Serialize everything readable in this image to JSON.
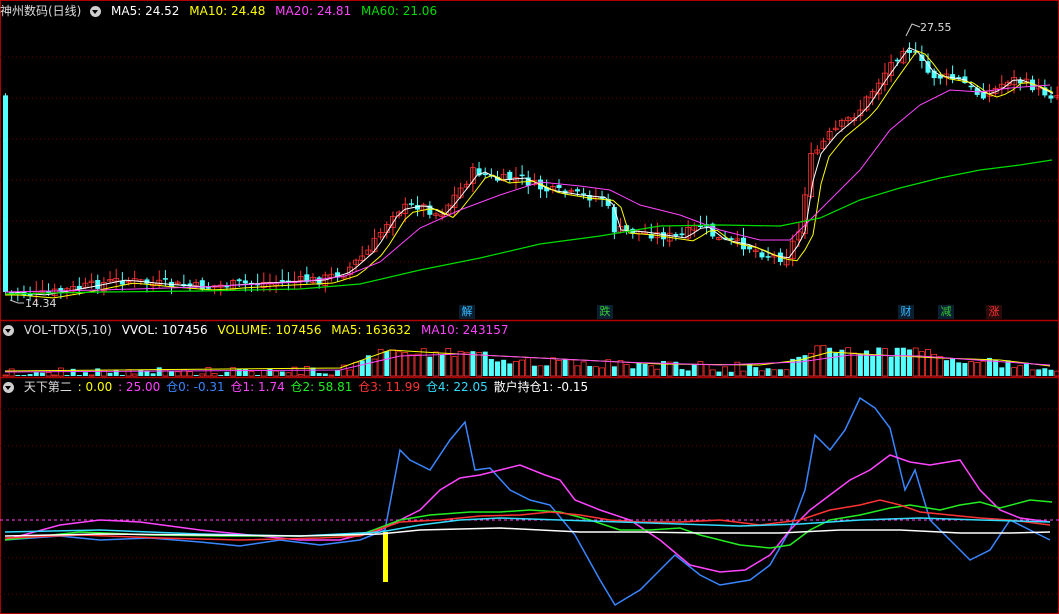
{
  "main_panel": {
    "title": "神州数码(日线)",
    "indicators": [
      {
        "label": "MA5: 24.52",
        "color": "#ffffff"
      },
      {
        "label": "MA10: 24.48",
        "color": "#ffff00"
      },
      {
        "label": "MA20: 24.81",
        "color": "#ff44ff"
      },
      {
        "label": "MA60: 21.06",
        "color": "#00dd00"
      }
    ],
    "price_high_label": "27.55",
    "price_low_label": "14.34",
    "event_tags": [
      {
        "text": "解",
        "color": "#35b7ff"
      },
      {
        "text": "跌",
        "color": "#35c935"
      },
      {
        "text": "财",
        "color": "#35b7ff"
      },
      {
        "text": "减",
        "color": "#35c935"
      },
      {
        "text": "涨",
        "color": "#ff3333"
      }
    ]
  },
  "volume_panel": {
    "title": "VOL-TDX(5,10)",
    "indicators": [
      {
        "label": "VVOL: 107456",
        "color": "#ffffff"
      },
      {
        "label": "VOLUME: 107456",
        "color": "#ffff00"
      },
      {
        "label": "MA5: 163632",
        "color": "#ffff00"
      },
      {
        "label": "MA10: 243157",
        "color": "#ff44ff"
      }
    ]
  },
  "indicator_panel": {
    "title": "天下第二",
    "indicators": [
      {
        "label": ": 0.00",
        "color": "#ffff00"
      },
      {
        "label": ": 25.00",
        "color": "#ff44ff"
      },
      {
        "label": "仓0: -0.31",
        "color": "#3a86ff"
      },
      {
        "label": "仓1: 1.74",
        "color": "#ff44ff"
      },
      {
        "label": "仓2: 58.81",
        "color": "#22ee22"
      },
      {
        "label": "仓3: 11.99",
        "color": "#ff3333"
      },
      {
        "label": "仓4: 22.05",
        "color": "#33ddff"
      },
      {
        "label": "散户持仓1: -0.15",
        "color": "#ffffff"
      }
    ]
  },
  "colors": {
    "up": "#ff3333",
    "down": "#54ffff",
    "ma5": "#ffffff",
    "ma10": "#ffff00",
    "ma20": "#ff44ff",
    "ma60": "#00dd00",
    "frame": "#b00000"
  }
}
